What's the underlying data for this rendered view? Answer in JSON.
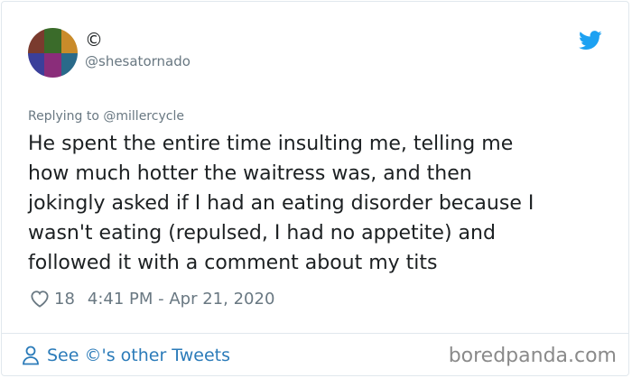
{
  "tweet": {
    "author": {
      "display_name": "©",
      "handle": "@shesatornado",
      "avatar_icon": "avatar-photo-collage"
    },
    "brand_icon": "twitter-bird-icon",
    "brand_color": "#1da1f2",
    "reply": {
      "prefix": "Replying to ",
      "mention": "@millercycle"
    },
    "text": "He spent the entire time insulting me, telling me\nhow much hotter the waitress was, and then\njokingly asked if I had an eating disorder because I\nwasn't eating (repulsed, I had no appetite) and\nfollowed it with a comment about my tits",
    "likes": "18",
    "timestamp": "4:41 PM - Apr 21, 2020",
    "footer_link": "See ©'s other Tweets",
    "link_color": "#2b7bb9"
  },
  "watermark": "boredpanda.com"
}
